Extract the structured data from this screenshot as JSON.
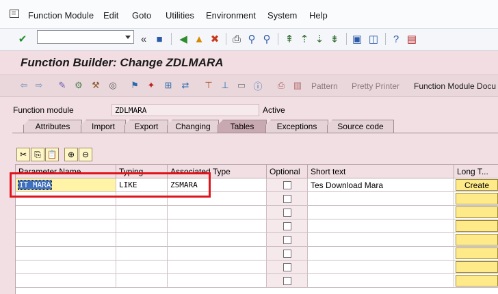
{
  "menubar": {
    "items": [
      "Function Module",
      "Edit",
      "Goto",
      "Utilities",
      "Environment",
      "System",
      "Help"
    ]
  },
  "toolbar": {
    "command_field_value": "",
    "icons": [
      "check-icon",
      "back-double-icon",
      "save-icon",
      "back-icon",
      "exit-icon",
      "cancel-icon",
      "print-icon",
      "find-icon",
      "find-next-icon",
      "first-page-icon",
      "previous-page-icon",
      "next-page-icon",
      "last-page-icon",
      "create-session-icon",
      "shortcut-icon",
      "help-icon",
      "customize-layout-icon"
    ]
  },
  "header": {
    "title": "Function Builder: Change ZDLMARA"
  },
  "app_toolbar": {
    "pattern_label": "Pattern",
    "pretty_printer_label": "Pretty Printer",
    "fm_doc_label": "Function Module Docu"
  },
  "function_module": {
    "label": "Function module",
    "value": "ZDLMARA",
    "status": "Active"
  },
  "tabs": [
    "Attributes",
    "Import",
    "Export",
    "Changing",
    "Tables",
    "Exceptions",
    "Source code"
  ],
  "active_tab": "Tables",
  "table": {
    "headers": [
      "Parameter Name",
      "Typing",
      "Associated Type",
      "Optional",
      "Short text",
      "Long T..."
    ],
    "rows": [
      {
        "param": "IT_MARA",
        "typing": "LIKE",
        "assoc": "ZSMARA",
        "short_text": "Tes Download Mara",
        "long_text_button": "Create"
      }
    ]
  },
  "colors": {
    "highlight": "#e0121b",
    "input_yellow": "#fff3a8",
    "header_bg": "#f1dde2"
  }
}
